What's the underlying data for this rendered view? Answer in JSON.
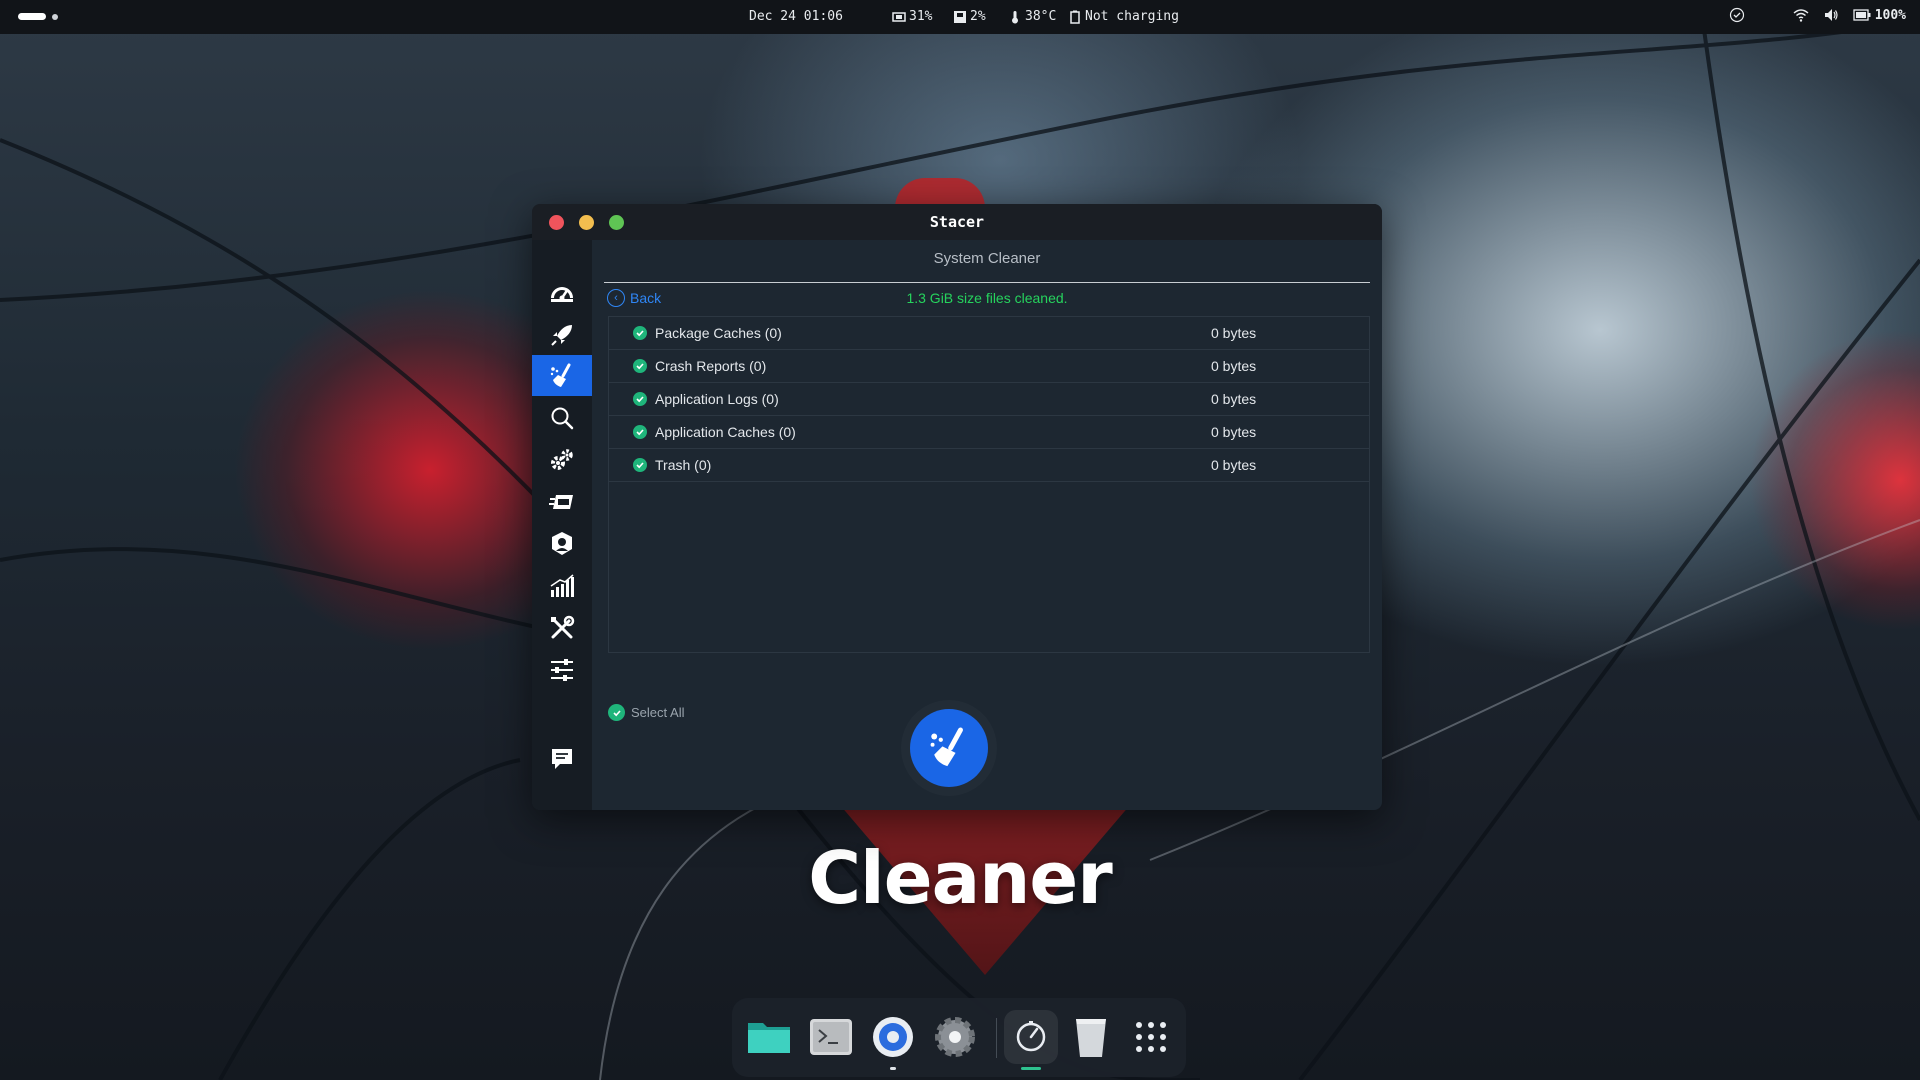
{
  "topbar": {
    "datetime": "Dec 24 01:06",
    "cpu": "31%",
    "disk": "2%",
    "temperature": "38°C",
    "battery_state": "Not charging",
    "battery_level": "100%",
    "icons": [
      "activities-indicator",
      "cpu-icon",
      "disk-icon",
      "thermometer-icon",
      "battery-status-icon",
      "notification-check-icon",
      "wifi-icon",
      "volume-icon",
      "battery-icon"
    ]
  },
  "window": {
    "title": "Stacer",
    "page_title": "System Cleaner",
    "back_label": "Back",
    "status_message": "1.3 GiB size files cleaned.",
    "status_color": "#26d35d",
    "accent_color": "#1a66e6",
    "sidebar": [
      {
        "icon": "dashboard-gauge-icon",
        "active": false
      },
      {
        "icon": "startup-rocket-icon",
        "active": false
      },
      {
        "icon": "system-cleaner-broom-icon",
        "active": true
      },
      {
        "icon": "search-icon",
        "active": false
      },
      {
        "icon": "services-gears-icon",
        "active": false
      },
      {
        "icon": "processes-icon",
        "active": false
      },
      {
        "icon": "uninstaller-icon",
        "active": false
      },
      {
        "icon": "resources-chart-icon",
        "active": false
      },
      {
        "icon": "helpers-tools-icon",
        "active": false
      },
      {
        "icon": "settings-sliders-icon",
        "active": false
      },
      {
        "icon": "feedback-chat-icon",
        "active": false
      }
    ],
    "cleaner_items": [
      {
        "label": "Package Caches (0)",
        "size": "0 bytes",
        "checked": true
      },
      {
        "label": "Crash Reports (0)",
        "size": "0 bytes",
        "checked": true
      },
      {
        "label": "Application Logs (0)",
        "size": "0 bytes",
        "checked": true
      },
      {
        "label": "Application Caches (0)",
        "size": "0 bytes",
        "checked": true
      },
      {
        "label": "Trash (0)",
        "size": "0 bytes",
        "checked": true
      }
    ],
    "select_all_label": "Select All",
    "clean_button_icon": "broom-icon"
  },
  "wallpaper": {
    "caption": "Cleaner"
  },
  "dock": {
    "items": [
      {
        "icon": "files-folder-icon",
        "running": false
      },
      {
        "icon": "terminal-icon",
        "running": false
      },
      {
        "icon": "browser-icon",
        "running": true
      },
      {
        "icon": "settings-gear-icon",
        "running": false
      },
      {
        "icon": "stacer-app-icon",
        "running": true
      },
      {
        "icon": "trash-icon",
        "running": false
      },
      {
        "icon": "app-grid-icon",
        "running": false
      }
    ]
  }
}
